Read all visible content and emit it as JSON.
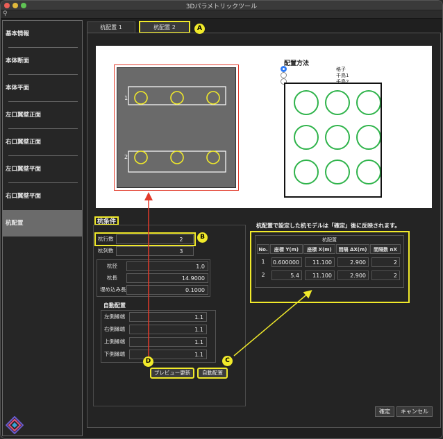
{
  "window": {
    "title": "3Dパラメトリックツール"
  },
  "sidebar": {
    "items": [
      {
        "label": "基本情報"
      },
      {
        "label": "本体断面"
      },
      {
        "label": "本体平面"
      },
      {
        "label": "左口翼壁正面"
      },
      {
        "label": "右口翼壁正面"
      },
      {
        "label": "左口翼壁平面"
      },
      {
        "label": "右口翼壁平面"
      },
      {
        "label": "杭配置",
        "active": true
      }
    ]
  },
  "tabs": [
    {
      "label": "杭配置 1"
    },
    {
      "label": "杭配置 2",
      "active": true
    }
  ],
  "preview": {
    "row_labels": [
      "1",
      "2"
    ]
  },
  "arrangement": {
    "title": "配置方法",
    "options": [
      {
        "label": "格子",
        "selected": true
      },
      {
        "label": "千鳥1",
        "selected": false
      },
      {
        "label": "千鳥2",
        "selected": false
      }
    ]
  },
  "conditions": {
    "title": "杭条件",
    "pile_rows_label": "杭行数",
    "pile_rows_value": "2",
    "pile_cols_label": "杭列数",
    "pile_cols_value": "3",
    "diameter_label": "杭径",
    "diameter_value": "1.0",
    "length_label": "杭長",
    "length_value": "14.9000",
    "embed_label": "埋め込み長",
    "embed_value": "0.1000"
  },
  "auto": {
    "title": "自動配置",
    "left_label": "左側縁端",
    "left_value": "1.1",
    "right_label": "右側縁端",
    "right_value": "1.1",
    "top_label": "上側縁端",
    "top_value": "1.1",
    "bottom_label": "下側縁端",
    "bottom_value": "1.1",
    "preview_button": "プレビュー更新",
    "auto_button": "自動配置"
  },
  "note": "杭配置で設定した杭モデルは「確定」後に反映されます。",
  "pile_table": {
    "title": "杭配置",
    "headers": [
      "No.",
      "座標 Y(m)",
      "座標 X(m)",
      "間隔 ΔX(m)",
      "間隔数 nX"
    ],
    "rows": [
      [
        "1",
        "0.600000",
        "11.100",
        "2.900",
        "2"
      ],
      [
        "2",
        "5.4",
        "11.100",
        "2.900",
        "2"
      ]
    ]
  },
  "markers": [
    "A",
    "B",
    "C",
    "D"
  ],
  "footer": {
    "ok_button": "確定",
    "cancel_button": "キャンセル"
  },
  "colors": {
    "highlight": "#f1ea2a",
    "pile_preview": "#f1ea2a",
    "grid_circle": "#2eb34a",
    "frame_red": "#e23a2a",
    "radio_selected": "#2f7bf5"
  }
}
